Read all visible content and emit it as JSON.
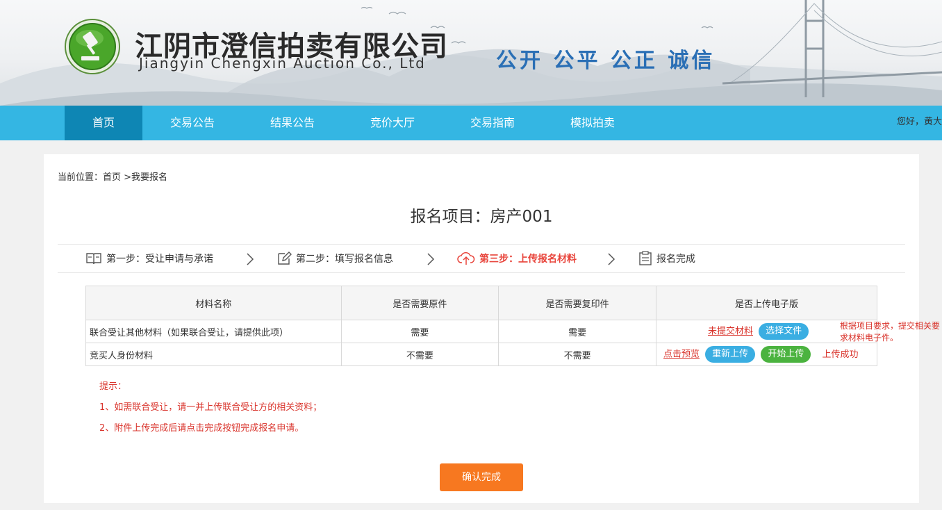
{
  "header": {
    "company_cn": "江阴市澄信拍卖有限公司",
    "company_en": "Jiangyin Chengxin Auction Co., Ltd",
    "slogan": "公开 公平 公正 诚信"
  },
  "nav": {
    "items": [
      {
        "label": "首页",
        "active": true
      },
      {
        "label": "交易公告"
      },
      {
        "label": "结果公告"
      },
      {
        "label": "竞价大厅"
      },
      {
        "label": "交易指南"
      },
      {
        "label": "模拟拍卖"
      }
    ],
    "greeting": "您好，黄大"
  },
  "breadcrumb": "当前位置：首页 >我要报名",
  "project_title": "报名项目：房产001",
  "steps": [
    {
      "label": "第一步：受让申请与承诺",
      "icon": "book-icon"
    },
    {
      "label": "第二步：填写报名信息",
      "icon": "edit-icon"
    },
    {
      "label": "第三步：上传报名材料",
      "icon": "cloud-upload-icon",
      "current": true
    },
    {
      "label": "报名完成",
      "icon": "clipboard-icon"
    }
  ],
  "table": {
    "headers": [
      "材料名称",
      "是否需要原件",
      "是否需要复印件",
      "是否上传电子版"
    ],
    "rows": [
      {
        "name": "联合受让其他材料（如果联合受让，请提供此项）",
        "original": "需要",
        "copy": "需要",
        "link": "未提交材料",
        "btn1": "选择文件"
      },
      {
        "name": "竞买人身份材料",
        "original": "不需要",
        "copy": "不需要",
        "link": "点击预览",
        "btn1": "重新上传",
        "btn2": "开始上传",
        "status": "上传成功"
      }
    ]
  },
  "side_note": "根据项目要求，提交相关要求材料电子件。",
  "tips": {
    "title": "提示：",
    "line1": "1、如需联合受让，请一并上传联合受让方的相关资料；",
    "line2": "2、附件上传完成后请点击完成按钮完成报名申请。"
  },
  "confirm_label": "确认完成",
  "colors": {
    "nav": "#34b6e3",
    "nav_active": "#0e86b4",
    "accent_red": "#d9332b",
    "confirm": "#f77820",
    "btn_blue": "#3aaee2",
    "btn_green": "#4bb33f"
  }
}
